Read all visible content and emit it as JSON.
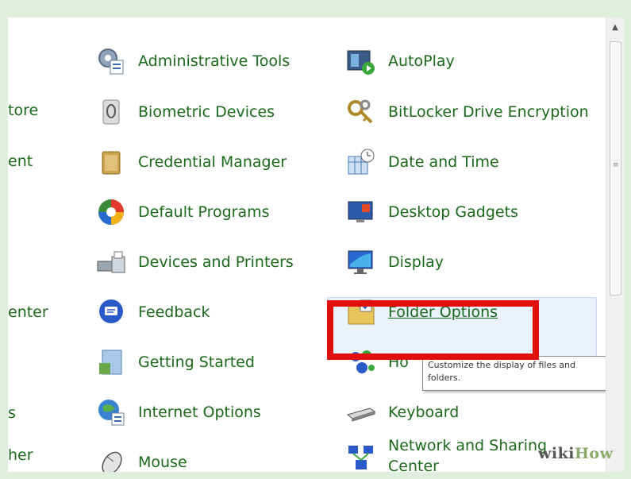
{
  "left_partial": [
    {
      "text": "tore"
    },
    {
      "text": "ent"
    },
    {
      "text": "enter"
    },
    {
      "text": "s"
    },
    {
      "text": "her"
    }
  ],
  "column1": [
    {
      "label": "Administrative Tools",
      "icon": "administrative-tools-icon"
    },
    {
      "label": "Biometric Devices",
      "icon": "biometric-devices-icon"
    },
    {
      "label": "Credential Manager",
      "icon": "credential-manager-icon"
    },
    {
      "label": "Default Programs",
      "icon": "default-programs-icon"
    },
    {
      "label": "Devices and Printers",
      "icon": "devices-and-printers-icon"
    },
    {
      "label": "Feedback",
      "icon": "feedback-icon"
    },
    {
      "label": "Getting Started",
      "icon": "getting-started-icon"
    },
    {
      "label": "Internet Options",
      "icon": "internet-options-icon"
    },
    {
      "label": "Mouse",
      "icon": "mouse-icon"
    }
  ],
  "column2": [
    {
      "label": "AutoPlay",
      "icon": "autoplay-icon"
    },
    {
      "label": "BitLocker Drive Encryption",
      "icon": "bitlocker-icon"
    },
    {
      "label": "Date and Time",
      "icon": "date-and-time-icon"
    },
    {
      "label": "Desktop Gadgets",
      "icon": "desktop-gadgets-icon"
    },
    {
      "label": "Display",
      "icon": "display-icon"
    },
    {
      "label": "Folder Options",
      "icon": "folder-options-icon"
    },
    {
      "label": "Ho",
      "icon": "homegroup-icon"
    },
    {
      "label": "Keyboard",
      "icon": "keyboard-icon"
    },
    {
      "label": "Network and Sharing",
      "label2": "Center",
      "icon": "network-icon"
    }
  ],
  "tooltip": {
    "line1": "Customize the display of files and",
    "line2": "folders."
  },
  "watermark": {
    "wiki": "wiki",
    "how": "How"
  },
  "colors": {
    "link": "#1a6a1a",
    "highlight_box": "#e20e0e",
    "background": "#ffffff"
  }
}
